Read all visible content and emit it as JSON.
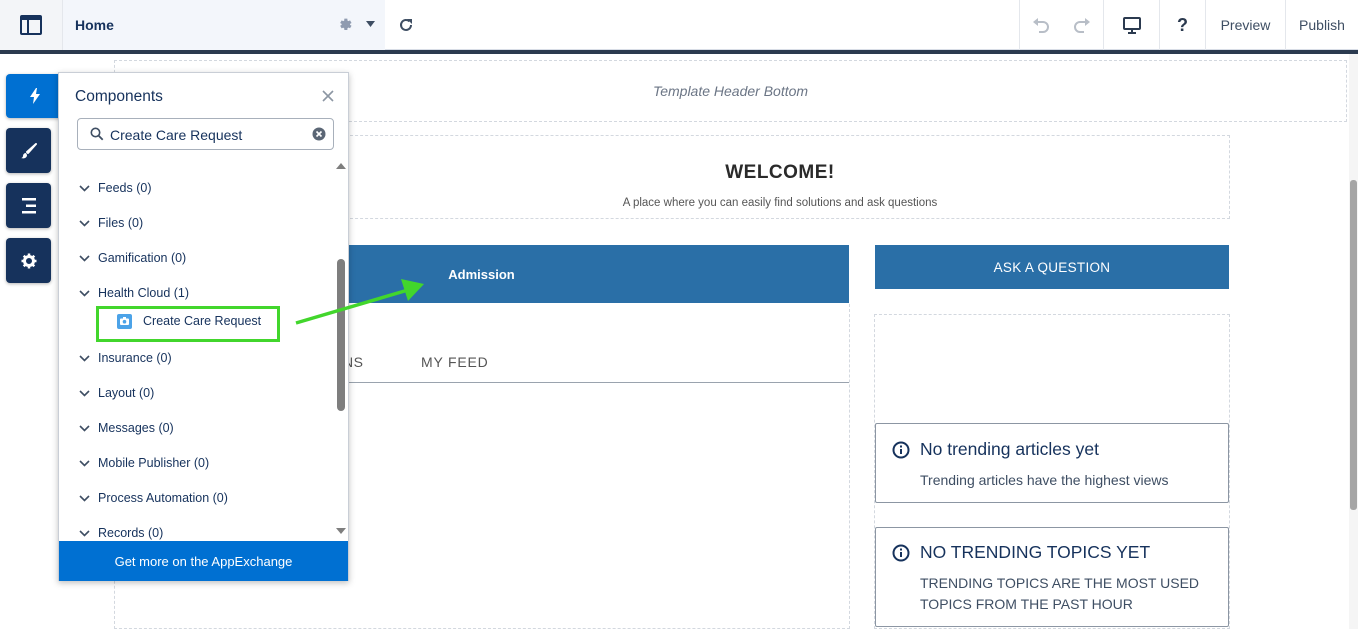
{
  "topbar": {
    "page_name": "Home",
    "preview_label": "Preview",
    "publish_label": "Publish",
    "help_label": "?",
    "icons": [
      "app-menu-icon",
      "gear-icon",
      "caret-down-icon",
      "refresh-icon",
      "undo-icon",
      "redo-icon",
      "desktop-icon",
      "help-icon"
    ]
  },
  "rail": {
    "icons": [
      "lightning-icon",
      "brush-icon",
      "pages-icon",
      "gear-icon"
    ]
  },
  "panel": {
    "title": "Components",
    "search_value": "Create Care Request",
    "categories": [
      {
        "label": "Feeds (0)"
      },
      {
        "label": "Files (0)"
      },
      {
        "label": "Gamification (0)"
      },
      {
        "label": "Health Cloud (1)"
      },
      {
        "label": "Insurance (0)"
      },
      {
        "label": "Layout (0)"
      },
      {
        "label": "Messages (0)"
      },
      {
        "label": "Mobile Publisher (0)"
      },
      {
        "label": "Process Automation (0)"
      },
      {
        "label": "Records (0)"
      }
    ],
    "component_item": "Create Care Request",
    "footer_label": "Get more on the AppExchange"
  },
  "canvas": {
    "template_header": "Template Header Bottom",
    "welcome_title": "WELCOME!",
    "welcome_subtitle": "A place where you can easily find solutions and ask questions",
    "admission_label": "Admission",
    "tabs": [
      "NS",
      "MY FEED"
    ],
    "ask_button": "ASK A QUESTION",
    "cards": [
      {
        "title": "No trending articles yet",
        "subtitle": "Trending articles have the highest views"
      },
      {
        "title": "NO TRENDING TOPICS YET",
        "subtitle_line1": "TRENDING TOPICS ARE THE MOST USED",
        "subtitle_line2": "TOPICS FROM THE PAST HOUR"
      }
    ]
  },
  "colors": {
    "brand_blue": "#0070d2",
    "navy": "#16325c",
    "section_blue": "#2a6fa7",
    "highlight_green": "#42d62c"
  }
}
